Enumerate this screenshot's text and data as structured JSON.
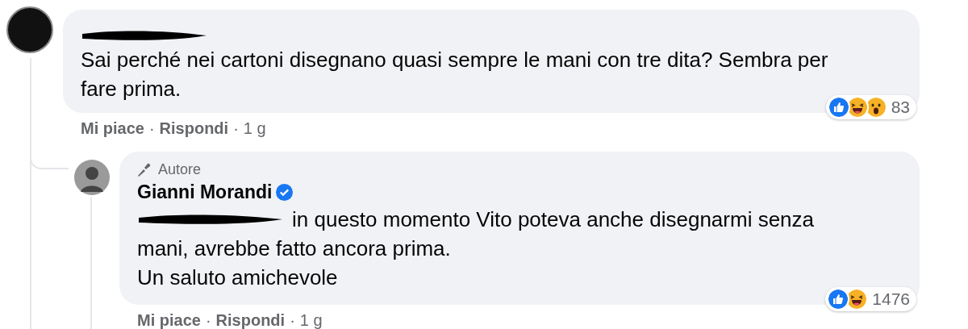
{
  "comments": [
    {
      "author_redacted": true,
      "lines": [
        "Sai perché nei cartoni disegnano quasi sempre le mani con tre dita? Sembra per",
        "fare prima."
      ],
      "actions": [
        "Mi piace",
        "Rispondi"
      ],
      "separator": "·",
      "time": "1 g",
      "reactions": [
        {
          "kind": "like"
        },
        {
          "kind": "haha"
        },
        {
          "kind": "wow"
        }
      ],
      "reaction_count": "83"
    },
    {
      "badge": "Autore",
      "author": "Gianni Morandi",
      "verified": true,
      "mention_redacted": true,
      "lines": [
        "in questo momento Vito poteva anche disegnarmi senza",
        "mani, avrebbe fatto ancora prima.",
        "Un saluto amichevole"
      ],
      "actions": [
        "Mi piace",
        "Rispondi"
      ],
      "separator": "·",
      "time": "1 g",
      "reactions": [
        {
          "kind": "like"
        },
        {
          "kind": "haha"
        }
      ],
      "reaction_count": "1476"
    }
  ]
}
